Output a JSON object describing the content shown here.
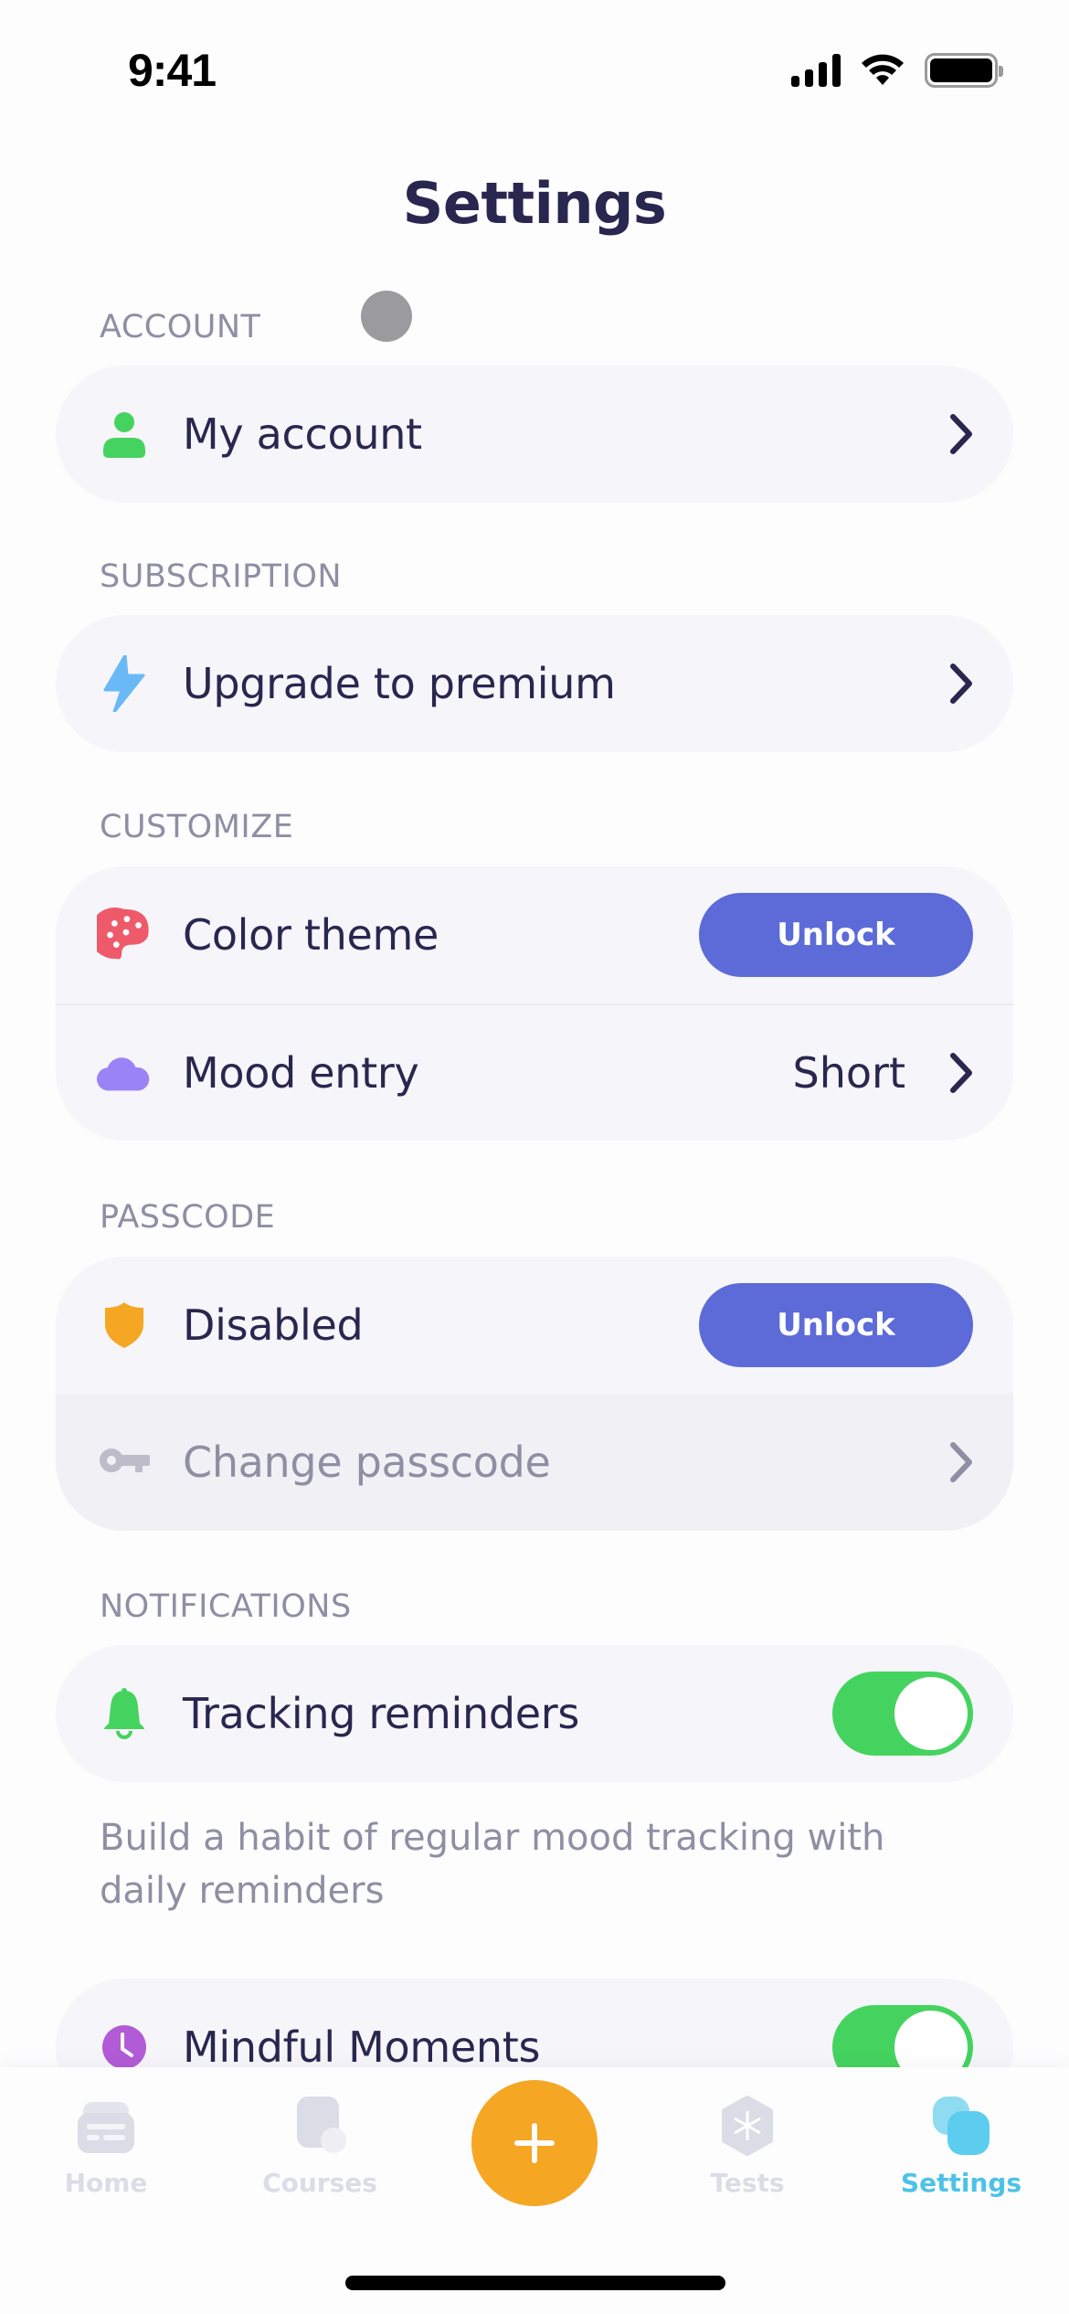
{
  "status_bar": {
    "time": "9:41"
  },
  "header": {
    "title": "Settings"
  },
  "sections": {
    "account": {
      "label": "ACCOUNT",
      "rows": [
        {
          "label": "My account",
          "icon": "person-icon",
          "icon_color": "#45d35f"
        }
      ]
    },
    "subscription": {
      "label": "SUBSCRIPTION",
      "rows": [
        {
          "label": "Upgrade to premium",
          "icon": "lightning-icon",
          "icon_color": "#6ab8f5"
        }
      ]
    },
    "customize": {
      "label": "CUSTOMIZE",
      "rows": [
        {
          "label": "Color theme",
          "icon": "palette-icon",
          "icon_color": "#ef5a6b",
          "button": "Unlock"
        },
        {
          "label": "Mood entry",
          "icon": "cloud-icon",
          "icon_color": "#9a83f7",
          "value": "Short"
        }
      ]
    },
    "passcode": {
      "label": "PASSCODE",
      "rows": [
        {
          "label": "Disabled",
          "icon": "shield-icon",
          "icon_color": "#f5a623",
          "button": "Unlock"
        },
        {
          "label": "Change passcode",
          "icon": "key-icon",
          "icon_color": "#bdbcc8",
          "disabled": true
        }
      ]
    },
    "notifications": {
      "label": "NOTIFICATIONS",
      "rows": [
        {
          "label": "Tracking reminders",
          "icon": "bell-icon",
          "icon_color": "#45d35f",
          "toggle_on": true
        },
        {
          "label": "Mindful Moments",
          "icon": "clock-icon",
          "icon_color": "#b25bd6",
          "toggle_on": true
        }
      ],
      "description": "Build a habit of regular mood tracking with daily reminders"
    }
  },
  "colors": {
    "accent_button": "#5c6bd8",
    "toggle_on": "#45d35f",
    "fab": "#f5a623",
    "active_tab": "#4cc3e6",
    "text_primary": "#29264f",
    "text_secondary": "#8f8ea3"
  },
  "tab_bar": {
    "tabs": [
      {
        "label": "Home",
        "icon": "home-icon",
        "active": false
      },
      {
        "label": "Courses",
        "icon": "courses-icon",
        "active": false
      },
      {
        "label": "Tests",
        "icon": "tests-icon",
        "active": false
      },
      {
        "label": "Settings",
        "icon": "settings-icon",
        "active": true
      }
    ],
    "fab_icon": "plus-icon"
  }
}
